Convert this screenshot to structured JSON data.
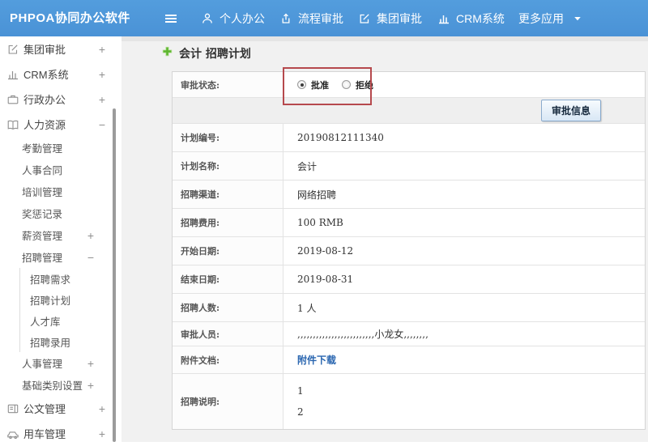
{
  "colors": {
    "navbar_blue": "#4a92d6",
    "annotation_red": "#b6494d",
    "link_blue": "#2a66b0",
    "add_icon_green": "#5db52f",
    "button_bg": "#d8e7f5"
  },
  "navbar": {
    "brand": "PHPOA协同办公软件",
    "menu": [
      {
        "label": "个人办公",
        "icon": "user-icon"
      },
      {
        "label": "流程审批",
        "icon": "process-approval-icon"
      },
      {
        "label": "集团审批",
        "icon": "edit-square-icon"
      },
      {
        "label": "CRM系统",
        "icon": "bar-chart-icon"
      },
      {
        "label": "更多应用",
        "icon": "caret-down-icon"
      }
    ]
  },
  "sidebar": {
    "items": [
      {
        "label": "集团审批",
        "toggle": "+",
        "icon": "edit-square-icon",
        "level": 1
      },
      {
        "label": "CRM系统",
        "toggle": "+",
        "icon": "bar-chart-icon",
        "level": 1
      },
      {
        "label": "行政办公",
        "toggle": "+",
        "icon": "briefcase-icon",
        "level": 1
      },
      {
        "label": "人力资源",
        "toggle": "−",
        "icon": "book-icon",
        "level": 1
      },
      {
        "label": "考勤管理",
        "level": 2
      },
      {
        "label": "人事合同",
        "level": 2
      },
      {
        "label": "培训管理",
        "level": 2
      },
      {
        "label": "奖惩记录",
        "level": 2
      },
      {
        "label": "薪资管理",
        "toggle": "+",
        "level": 2
      },
      {
        "label": "招聘管理",
        "toggle": "−",
        "level": 2
      },
      {
        "label": "招聘需求",
        "level": 3
      },
      {
        "label": "招聘计划",
        "level": 3
      },
      {
        "label": "人才库",
        "level": 3
      },
      {
        "label": "招聘录用",
        "level": 3
      },
      {
        "label": "人事管理",
        "toggle": "+",
        "level": 2
      },
      {
        "label": "基础类别设置",
        "toggle": "+",
        "level": 2
      },
      {
        "label": "公文管理",
        "toggle": "+",
        "icon": "document-icon",
        "level": 1
      },
      {
        "label": "用车管理",
        "toggle": "+",
        "icon": "car-icon",
        "level": 1
      }
    ]
  },
  "main": {
    "page_title": "会计 招聘计划",
    "status_row": {
      "label": "审批状态:",
      "approve": "批准",
      "reject": "拒绝",
      "selected": "批准"
    },
    "approval_info_button": "审批信息",
    "rows": [
      {
        "label": "计划编号:",
        "value": "20190812111340"
      },
      {
        "label": "计划名称:",
        "value": "会计"
      },
      {
        "label": "招聘渠道:",
        "value": "网络招聘"
      },
      {
        "label": "招聘费用:",
        "value": "100 RMB"
      },
      {
        "label": "开始日期:",
        "value": "2019-08-12"
      },
      {
        "label": "结束日期:",
        "value": "2019-08-31"
      },
      {
        "label": "招聘人数:",
        "value": "1 人"
      },
      {
        "label": "审批人员:",
        "value": ",,,,,,,,,,,,,,,,,,,,,,,,,小龙女,,,,,,,,"
      },
      {
        "label": "附件文档:",
        "link": "附件下载"
      },
      {
        "label": "招聘说明:",
        "line1": "1",
        "line2": "2"
      }
    ]
  }
}
